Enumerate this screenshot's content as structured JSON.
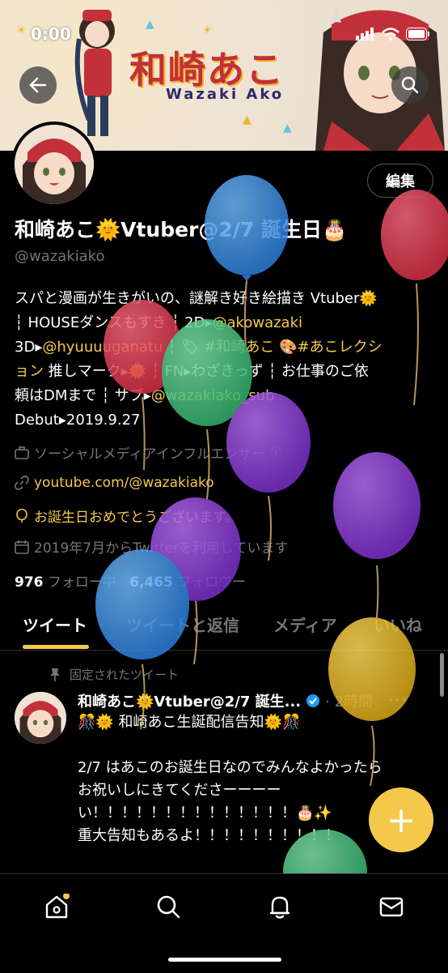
{
  "status_bar": {
    "time": "0:00"
  },
  "banner": {
    "title": "和崎あこ",
    "subtitle": "Wazaki  Ako"
  },
  "profile": {
    "edit_label": "編集",
    "name": "和崎あこ🌞Vtuber@2/7 誕生日🎂",
    "handle": "@wazakiako",
    "bio_lines": [
      [
        {
          "t": "スパと漫画が生きがいの、謎解き好き絵描き Vtuber🌞",
          "c": "w"
        }
      ],
      [
        {
          "t": "┆ HOUSEダンスもすき ┆ 2D▸",
          "c": "w"
        },
        {
          "t": "@akowazaki",
          "c": "y"
        }
      ],
      [
        {
          "t": "3D▸",
          "c": "w"
        },
        {
          "t": "@hyuuuuganatu",
          "c": "y"
        },
        {
          "t": " ┆ 🏷 ",
          "c": "w"
        },
        {
          "t": "#和崎あこ",
          "c": "y"
        },
        {
          "t": " 🎨",
          "c": "w"
        },
        {
          "t": "#あこレクシ",
          "c": "y"
        }
      ],
      [
        {
          "t": "ョン",
          "c": "y"
        },
        {
          "t": " 推しマーク▸🌞 ┆ FN▸わざきっず ┆ お仕事のご依",
          "c": "w"
        }
      ],
      [
        {
          "t": "頼はDMまで ┆ サブ▸",
          "c": "w"
        },
        {
          "t": "@wazakiako_sub",
          "c": "y"
        }
      ],
      [
        {
          "t": "Debut▸2019.9.27",
          "c": "w"
        }
      ]
    ],
    "category": "ソーシャルメディアインフルエンサー",
    "link": "youtube.com/@wazakiako",
    "birthday": "お誕生日おめでとうございます。",
    "joined": "2019年7月からTwitterを利用しています",
    "following_count": "976",
    "following_label": "フォロー中",
    "followers_count": "6,465",
    "followers_label": "フォロワー"
  },
  "tabs": [
    {
      "label": "ツイート",
      "active": true
    },
    {
      "label": "ツイートと返信",
      "active": false
    },
    {
      "label": "メディア",
      "active": false
    },
    {
      "label": "いいね",
      "active": false
    }
  ],
  "tweet": {
    "pinned_label": "固定されたツイート",
    "author": "和崎あこ🌞Vtuber@2/7 誕生...",
    "time": "· 2時間",
    "more": "•••",
    "lines": [
      "🎊🌞 和崎あこ生誕配信告知🌞🎊",
      "",
      "2/7 はあこのお誕生日なのでみんなよかったら",
      "お祝いしにきてくださーーーー",
      "い！！！！！！！！！！！！！！🎂✨",
      "重大告知もあるよ！！！！！！！！！！"
    ]
  },
  "fab_label": "+",
  "colors": {
    "accent": "#f4c84b",
    "muted": "#71767b",
    "banner_red": "#c2303a"
  }
}
